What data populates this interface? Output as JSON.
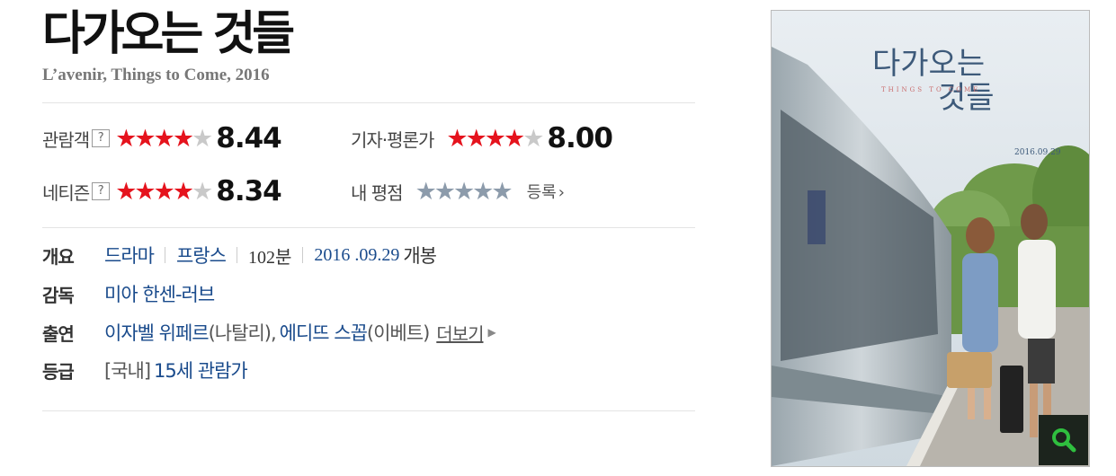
{
  "movie": {
    "title": "다가오는 것들",
    "subtitle": "L’avenir, Things to Come, 2016"
  },
  "ratings": {
    "audience": {
      "label": "관람객",
      "help": "?",
      "stars_filled": 4,
      "stars_total": 5,
      "score": "8.44"
    },
    "critics": {
      "label": "기자·평론가",
      "stars_filled": 4,
      "stars_total": 5,
      "score": "8.00"
    },
    "netizen": {
      "label": "네티즌",
      "help": "?",
      "stars_filled": 4,
      "stars_total": 5,
      "score": "8.34"
    },
    "my": {
      "label": "내 평점",
      "stars_total": 5,
      "register_label": "등록"
    }
  },
  "info": {
    "summary": {
      "label": "개요",
      "genre": "드라마",
      "country": "프랑스",
      "runtime": "102분",
      "release_date": "2016 .09.29",
      "release_suffix": "개봉"
    },
    "director": {
      "label": "감독",
      "name": "미아 한센-러브"
    },
    "cast": {
      "label": "출연",
      "actor1": "이자벨 위페르",
      "role1": "(나탈리),",
      "actor2": "에디뜨 스꼽",
      "role2": "(이베트)",
      "more_label": "더보기"
    },
    "rating": {
      "label": "등급",
      "prefix": "[국내]",
      "value": "15세 관람가"
    }
  },
  "poster": {
    "title": "다가오는 것들",
    "subtitle": "THINGS TO COME",
    "date": "2016.09.29",
    "zoom_icon": "magnifier-icon"
  },
  "colors": {
    "star_on": "#e5131d",
    "star_off": "#c9c9c9",
    "my_star": "#8c9bab",
    "link": "#1a4b8c"
  }
}
